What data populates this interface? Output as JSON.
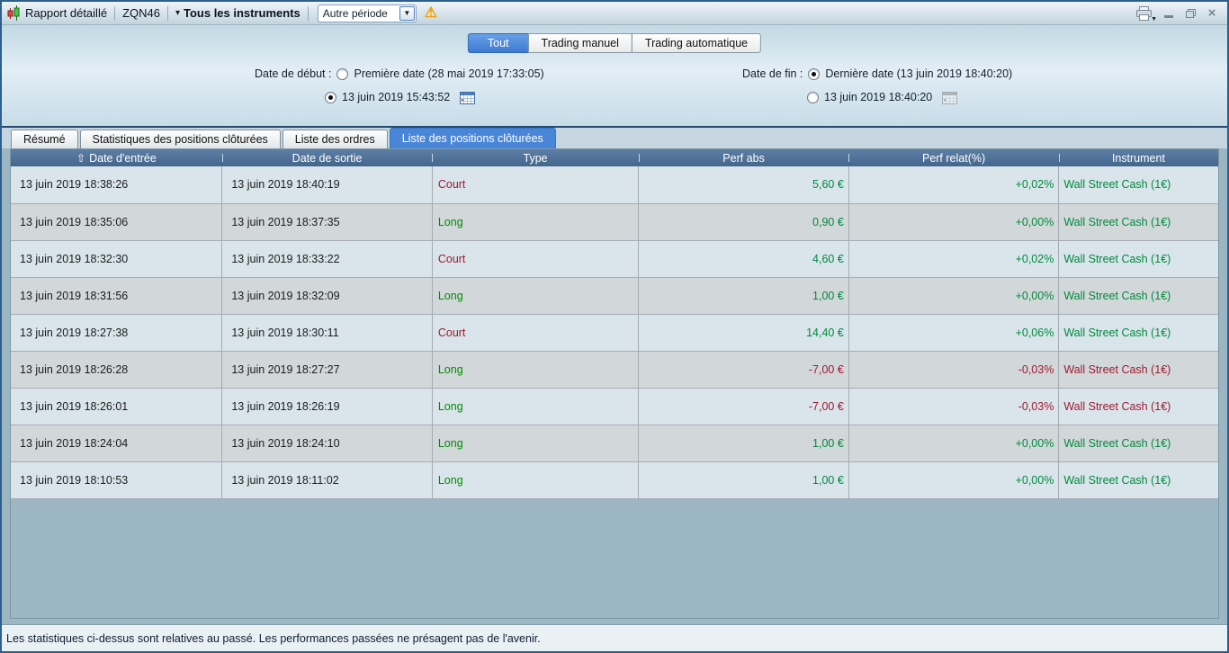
{
  "colors": {
    "accent_blue": "#4a86d8",
    "header_blue": "#4f7096",
    "positive_green": "#008a3c",
    "negative_red": "#9f1b2f",
    "warning_orange": "#ef9f00",
    "row_odd": "#d9e5eb",
    "row_even": "#d2d7da"
  },
  "icons": {
    "sort_ascending": "⇧",
    "instruments_caret": "▾",
    "combo_arrow": "▼",
    "printer_caret": "▼",
    "warning": "⚠",
    "close": "×"
  },
  "toolbar": {
    "report_title": "Rapport détaillé",
    "report_code": "ZQN46",
    "instruments_selector": "Tous les instruments",
    "period_select_value": "Autre période"
  },
  "mode_tabs": {
    "items": [
      "Tout",
      "Trading manuel",
      "Trading automatique"
    ],
    "active": "Tout"
  },
  "filters": {
    "start": {
      "label": "Date de début :",
      "options": [
        {
          "label": "Première date (28 mai 2019 17:33:05)",
          "selected": false
        },
        {
          "label": "13 juin 2019 15:43:52",
          "selected": true,
          "calendar_enabled": true
        }
      ]
    },
    "end": {
      "label": "Date de fin :",
      "options": [
        {
          "label": "Dernière date (13 juin 2019 18:40:20)",
          "selected": true
        },
        {
          "label": "13 juin 2019 18:40:20",
          "selected": false,
          "calendar_enabled": false
        }
      ]
    }
  },
  "view_tabs": {
    "items": [
      "Résumé",
      "Statistiques des positions clôturées",
      "Liste des ordres",
      "Liste des positions clôturées"
    ],
    "active": "Liste des positions clôturées"
  },
  "table": {
    "columns": [
      "Date d'entrée",
      "Date de sortie",
      "Type",
      "Perf abs",
      "Perf relat(%)",
      "Instrument"
    ],
    "sorted_by": "Date d'entrée",
    "sort_direction": "ascending",
    "rows": [
      {
        "entry": "13 juin 2019 18:38:26",
        "exit": "13 juin 2019 18:40:19",
        "type": "Court",
        "perf_abs": "5,60 €",
        "perf_rel": "+0,02%",
        "instrument": "Wall Street Cash (1€)"
      },
      {
        "entry": "13 juin 2019 18:35:06",
        "exit": "13 juin 2019 18:37:35",
        "type": "Long",
        "perf_abs": "0,90 €",
        "perf_rel": "+0,00%",
        "instrument": "Wall Street Cash (1€)"
      },
      {
        "entry": "13 juin 2019 18:32:30",
        "exit": "13 juin 2019 18:33:22",
        "type": "Court",
        "perf_abs": "4,60 €",
        "perf_rel": "+0,02%",
        "instrument": "Wall Street Cash (1€)"
      },
      {
        "entry": "13 juin 2019 18:31:56",
        "exit": "13 juin 2019 18:32:09",
        "type": "Long",
        "perf_abs": "1,00 €",
        "perf_rel": "+0,00%",
        "instrument": "Wall Street Cash (1€)"
      },
      {
        "entry": "13 juin 2019 18:27:38",
        "exit": "13 juin 2019 18:30:11",
        "type": "Court",
        "perf_abs": "14,40 €",
        "perf_rel": "+0,06%",
        "instrument": "Wall Street Cash (1€)"
      },
      {
        "entry": "13 juin 2019 18:26:28",
        "exit": "13 juin 2019 18:27:27",
        "type": "Long",
        "perf_abs": "-7,00 €",
        "perf_rel": "-0,03%",
        "instrument": "Wall Street Cash (1€)"
      },
      {
        "entry": "13 juin 2019 18:26:01",
        "exit": "13 juin 2019 18:26:19",
        "type": "Long",
        "perf_abs": "-7,00 €",
        "perf_rel": "-0,03%",
        "instrument": "Wall Street Cash (1€)"
      },
      {
        "entry": "13 juin 2019 18:24:04",
        "exit": "13 juin 2019 18:24:10",
        "type": "Long",
        "perf_abs": "1,00 €",
        "perf_rel": "+0,00%",
        "instrument": "Wall Street Cash (1€)"
      },
      {
        "entry": "13 juin 2019 18:10:53",
        "exit": "13 juin 2019 18:11:02",
        "type": "Long",
        "perf_abs": "1,00 €",
        "perf_rel": "+0,00%",
        "instrument": "Wall Street Cash (1€)"
      }
    ]
  },
  "status_bar": {
    "text": "Les statistiques ci-dessus sont relatives au passé. Les performances passées ne présagent pas de l'avenir."
  }
}
